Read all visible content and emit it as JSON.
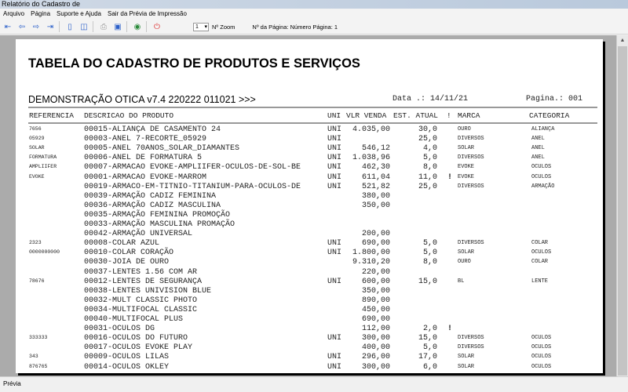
{
  "window": {
    "title": "Relatório do Cadastro de"
  },
  "menu": [
    "Arquivo",
    "Página",
    "Suporte e Ajuda",
    "Sair da Prévia de Impressão"
  ],
  "toolbar": {
    "zoom_value": "1",
    "zoom_label": "Nº Zoom",
    "page_label": "Nº da Página: Número Página: 1"
  },
  "report": {
    "title": "TABELA DO CADASTRO DE PRODUTOS E SERVIÇOS",
    "subtitle": "DEMONSTRAÇÃO OTICA v7.4 220222 011021 >>>",
    "date": "Data .: 14/11/21",
    "page": "Pagina.: 001",
    "headers": {
      "ref": "REFERENCIA",
      "desc": "DESCRICAO DO PRODUTO",
      "uni": "UNI",
      "vlr": "VLR VENDA",
      "est": "EST. ATUAL",
      "bang": "!",
      "marca": "MARCA",
      "cat": "CATEGORIA"
    },
    "rows": [
      [
        "7656",
        "00015-ALIANÇA DE CASAMENTO 24",
        "UNI",
        "4.035,00",
        "30,0",
        "",
        "OURO",
        "ALIANÇA"
      ],
      [
        "05929",
        "00003-ANEL 7-RECORTE_05929",
        "UNI",
        "",
        "25,0",
        "",
        "DIVERSOS",
        "ANEL"
      ],
      [
        "SOLAR",
        "00005-ANEL 70ANOS_SOLAR_DIAMANTES",
        "UNI",
        "546,12",
        "4,0",
        "",
        "SOLAR",
        "ANEL"
      ],
      [
        "FORMATURA",
        "00006-ANEL DE FORMATURA 5",
        "UNI",
        "1.038,96",
        "5,0",
        "",
        "DIVERSOS",
        "ANEL"
      ],
      [
        "AMPLIIFER",
        "00007-ARMACAO EVOKE-AMPLIIFER-OCULOS-DE-SOL-BE",
        "UNI",
        "462,30",
        "8,0",
        "",
        "EVOKE",
        "OCULOS"
      ],
      [
        "EVOKE",
        "00001-ARMACAO EVOKE-MARROM",
        "UNI",
        "611,04",
        "11,0",
        "!",
        "EVOKE",
        "OCULOS"
      ],
      [
        "",
        "00019-ARMACO-EM-TITNIO-TITANIUM-PARA-OCULOS-DE",
        "UNI",
        "521,82",
        "25,0",
        "",
        "DIVERSOS",
        "ARMAÇÃO"
      ],
      [
        "",
        "00039-ARMAÇÃO CADIZ FEMININA",
        "",
        "380,00",
        "",
        "",
        "",
        ""
      ],
      [
        "",
        "00036-ARMAÇÃO CADIZ MASCULINA",
        "",
        "350,00",
        "",
        "",
        "",
        ""
      ],
      [
        "",
        "00035-ARMAÇÃO FEMININA PROMOÇÃO",
        "",
        "",
        "",
        "",
        "",
        ""
      ],
      [
        "",
        "00033-ARMAÇÃO MASCULINA PROMAÇÃO",
        "",
        "",
        "",
        "",
        "",
        ""
      ],
      [
        "",
        "00042-ARMAÇÃO UNIVERSAL",
        "",
        "200,00",
        "",
        "",
        "",
        ""
      ],
      [
        "2323",
        "00008-COLAR AZUL",
        "UNI",
        "690,00",
        "5,0",
        "",
        "DIVERSOS",
        "COLAR"
      ],
      [
        "0000000000",
        "00010-COLAR CORAÇÃO",
        "UNI",
        "1.800,00",
        "5,0",
        "",
        "SOLAR",
        "OCULOS"
      ],
      [
        "",
        "00030-JOIA DE OURO",
        "",
        "9.310,20",
        "8,0",
        "",
        "OURO",
        "COLAR"
      ],
      [
        "",
        "00037-LENTES 1.56 COM AR",
        "",
        "220,00",
        "",
        "",
        "",
        ""
      ],
      [
        "78676",
        "00012-LENTES DE SEGURANÇA",
        "UNI",
        "600,00",
        "15,0",
        "",
        "BL",
        "LENTE"
      ],
      [
        "",
        "00038-LENTES UNIVISION BLUE",
        "",
        "350,00",
        "",
        "",
        "",
        ""
      ],
      [
        "",
        "00032-MULT CLASSIC PHOTO",
        "",
        "890,00",
        "",
        "",
        "",
        ""
      ],
      [
        "",
        "00034-MULTIFOCAL CLASSIC",
        "",
        "450,00",
        "",
        "",
        "",
        ""
      ],
      [
        "",
        "00040-MULTIFOCAL PLUS",
        "",
        "690,00",
        "",
        "",
        "",
        ""
      ],
      [
        "",
        "00031-OCULOS DG",
        "",
        "112,00",
        "2,0",
        "!",
        "",
        ""
      ],
      [
        "333333",
        "00016-OCULOS DO FUTURO",
        "UNI",
        "300,00",
        "15,0",
        "",
        "DIVERSOS",
        "OCULOS"
      ],
      [
        "",
        "00017-OCULOS EVOKE PLAY",
        "",
        "400,00",
        "5,0",
        "",
        "DIVERSOS",
        "OCULOS"
      ],
      [
        "343",
        "00009-OCULOS LILAS",
        "UNI",
        "296,00",
        "17,0",
        "",
        "SOLAR",
        "OCULOS"
      ],
      [
        "876765",
        "00014-OCULOS OKLEY",
        "UNI",
        "300,00",
        "6,0",
        "",
        "SOLAR",
        "OCULOS"
      ]
    ]
  },
  "status": {
    "text": "Prévia"
  }
}
